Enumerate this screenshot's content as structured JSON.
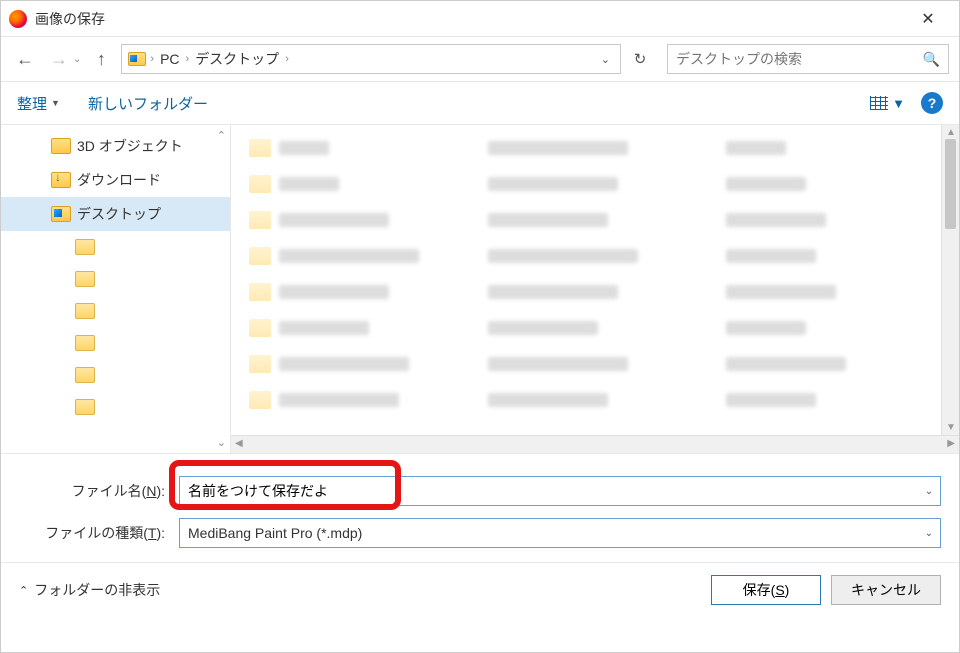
{
  "window": {
    "title": "画像の保存"
  },
  "breadcrumb": {
    "root": "PC",
    "current": "デスクトップ"
  },
  "search": {
    "placeholder": "デスクトップの検索"
  },
  "toolbar": {
    "organize": "整理",
    "new_folder": "新しいフォルダー",
    "help": "?"
  },
  "sidebar": {
    "items": [
      {
        "label": "3D オブジェクト",
        "selected": false
      },
      {
        "label": "ダウンロード",
        "selected": false
      },
      {
        "label": "デスクトップ",
        "selected": true
      }
    ]
  },
  "form": {
    "filename_label_pre": "ファイル名(",
    "filename_label_key": "N",
    "filename_label_post": "):",
    "filename_value": "名前をつけて保存だよ",
    "filetype_label_pre": "ファイルの種類(",
    "filetype_label_key": "T",
    "filetype_label_post": "):",
    "filetype_value": "MediBang Paint Pro (*.mdp)"
  },
  "footer": {
    "hide_folders": "フォルダーの非表示",
    "save_pre": "保存(",
    "save_key": "S",
    "save_post": ")",
    "cancel": "キャンセル"
  }
}
